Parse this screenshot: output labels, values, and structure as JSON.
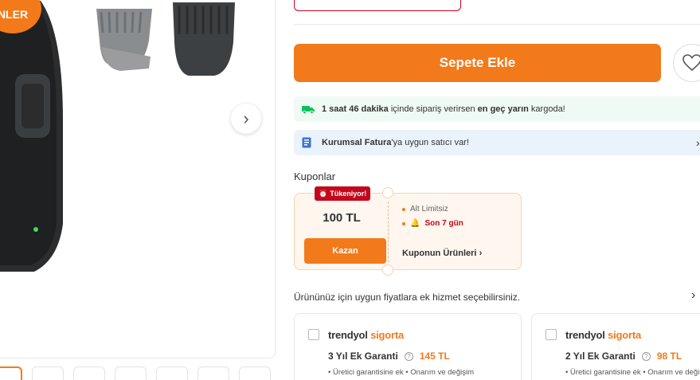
{
  "gallery": {
    "badge_text": "NLER",
    "next_icon": "chevron-right-icon",
    "thumbnails": [
      "thumb-1",
      "thumb-2",
      "thumb-3",
      "thumb-4",
      "thumb-5",
      "thumb-6",
      "thumb-7"
    ]
  },
  "product": {
    "add_to_cart_label": "Sepete Ekle",
    "favorite_icon": "heart-icon"
  },
  "delivery": {
    "time_bold": "1 saat 46 dakika",
    "text_mid": " içinde sipariş verirsen ",
    "bold2": "en geç yarın",
    "text_end": " kargoda!"
  },
  "invoice": {
    "bold": "Kurumsal Fatura",
    "text": "'ya uygun satıcı var!"
  },
  "coupons": {
    "title": "Kuponlar",
    "tag": "Tükeniyor!",
    "amount": "100 TL",
    "claim_label": "Kazan",
    "condition_1": "Alt Limitsiz",
    "condition_2": "Son 7 gün",
    "products_link": "Kuponun Ürünleri"
  },
  "services": {
    "title": "Ürününüz için uygun fiyatlara ek hizmet seçebilirsiniz.",
    "cards": [
      {
        "brand_a": "trendyol",
        "brand_b": "sigorta",
        "plan": "3 Yıl Ek Garanti",
        "price": "145 TL",
        "features": "• Üretici garantisine ek   • Onarım ve değişim"
      },
      {
        "brand_a": "trendyol",
        "brand_b": "sigorta",
        "plan": "2 Yıl Ek Garanti",
        "price": "98 TL",
        "features": "• Üretici garantisine ek   • Onarım ve değişim"
      }
    ]
  },
  "colors": {
    "accent": "#f27a1a",
    "danger": "#c4071d"
  }
}
